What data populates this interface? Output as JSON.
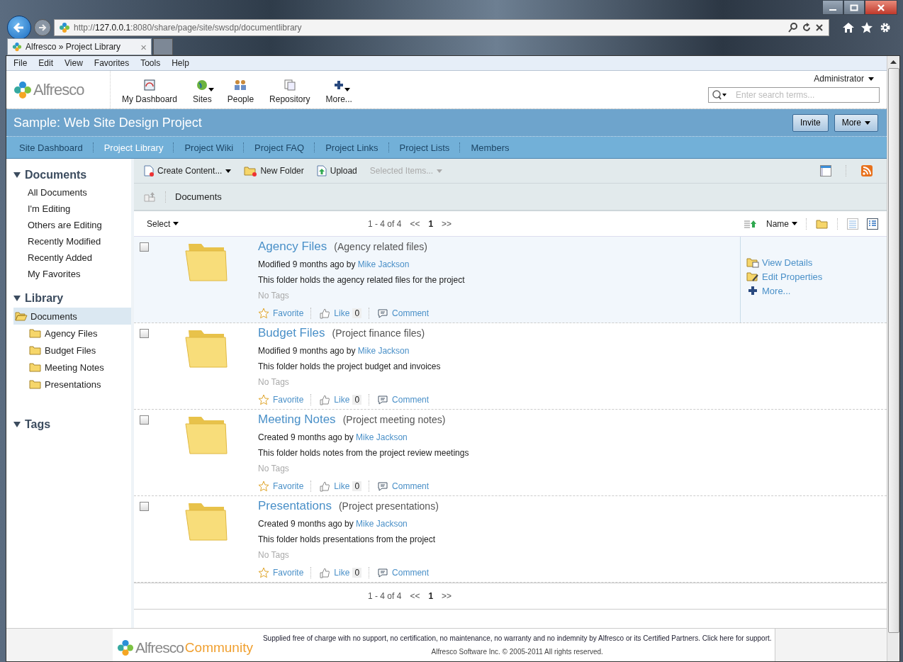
{
  "browser": {
    "url_host": "127.0.0.1",
    "url_prefix": "http://",
    "url_rest": ":8080/share/page/site/swsdp/documentlibrary",
    "tab_title": "Alfresco » Project Library",
    "tab_close": "×",
    "menu": [
      "File",
      "Edit",
      "View",
      "Favorites",
      "Tools",
      "Help"
    ]
  },
  "header": {
    "logo": "Alfresco",
    "nav": [
      {
        "label": "My Dashboard",
        "kind": "dashboard",
        "caret": false
      },
      {
        "label": "Sites",
        "kind": "sites",
        "caret": true
      },
      {
        "label": "People",
        "kind": "people",
        "caret": false
      },
      {
        "label": "Repository",
        "kind": "repository",
        "caret": false
      },
      {
        "label": "More...",
        "kind": "more",
        "caret": true
      }
    ],
    "user": "Administrator",
    "search_placeholder": "Enter search terms..."
  },
  "site": {
    "title": "Sample: Web Site Design Project",
    "buttons": [
      {
        "label": "Invite",
        "caret": false
      },
      {
        "label": "More",
        "caret": true
      }
    ],
    "nav": [
      {
        "label": "Site Dashboard",
        "selected": false
      },
      {
        "label": "Project Library",
        "selected": true
      },
      {
        "label": "Project Wiki",
        "selected": false
      },
      {
        "label": "Project FAQ",
        "selected": false
      },
      {
        "label": "Project Links",
        "selected": false
      },
      {
        "label": "Project Lists",
        "selected": false
      },
      {
        "label": "Members",
        "selected": false
      }
    ]
  },
  "sidebar": {
    "filters": {
      "title": "Documents",
      "expanded": true,
      "items": [
        "All Documents",
        "I'm Editing",
        "Others are Editing",
        "Recently Modified",
        "Recently Added",
        "My Favorites"
      ]
    },
    "library": {
      "title": "Library",
      "expanded": true,
      "tree": [
        {
          "label": "Documents",
          "selected": true,
          "expanded": true,
          "children": [
            {
              "label": "Agency Files",
              "selected": false
            },
            {
              "label": "Budget Files",
              "selected": false
            },
            {
              "label": "Meeting Notes",
              "selected": false
            },
            {
              "label": "Presentations",
              "selected": false
            }
          ]
        }
      ]
    },
    "tags": {
      "title": "Tags",
      "expanded": true
    }
  },
  "toolbar": {
    "actions": [
      {
        "label": "Create Content...",
        "kind": "create",
        "caret": true,
        "disabled": false
      },
      {
        "label": "New Folder",
        "kind": "folder",
        "caret": false,
        "disabled": false
      },
      {
        "label": "Upload",
        "kind": "upload",
        "caret": false,
        "disabled": false
      },
      {
        "label": "Selected Items...",
        "kind": "none",
        "caret": true,
        "disabled": true
      }
    ],
    "breadcrumb": "Documents"
  },
  "list": {
    "select": "Select",
    "sort": "Name",
    "pager": {
      "range": "1 - 4 of 4",
      "prev": "<<",
      "page": "1",
      "next": ">>"
    },
    "rows": [
      {
        "name": "Agency Files",
        "title": "(Agency related files)",
        "meta": "Modified 9 months ago by",
        "author": "Mike Jackson",
        "description": "This folder holds the agency related files for the project",
        "tags": "No Tags",
        "favorite": "Favorite",
        "like": "Like",
        "likes": "0",
        "comment": "Comment",
        "checked": false,
        "selected": true
      },
      {
        "name": "Budget Files",
        "title": "(Project finance files)",
        "meta": "Modified 9 months ago by",
        "author": "Mike Jackson",
        "description": "This folder holds the project budget and invoices",
        "tags": "No Tags",
        "favorite": "Favorite",
        "like": "Like",
        "likes": "0",
        "comment": "Comment",
        "checked": false,
        "selected": false
      },
      {
        "name": "Meeting Notes",
        "title": "(Project meeting notes)",
        "meta": "Created 9 months ago by",
        "author": "Mike Jackson",
        "description": "This folder holds notes from the project review meetings",
        "tags": "No Tags",
        "favorite": "Favorite",
        "like": "Like",
        "likes": "0",
        "comment": "Comment",
        "checked": false,
        "selected": false
      },
      {
        "name": "Presentations",
        "title": "(Project presentations)",
        "meta": "Created 9 months ago by",
        "author": "Mike Jackson",
        "description": "This folder holds presentations from the project",
        "tags": "No Tags",
        "favorite": "Favorite",
        "like": "Like",
        "likes": "0",
        "comment": "Comment",
        "checked": false,
        "selected": false
      }
    ],
    "bottom_pager": {
      "range": "1 - 4 of 4",
      "prev": "<<",
      "page": "1",
      "next": ">>"
    },
    "row_actions": [
      {
        "label": "View Details",
        "kind": "details"
      },
      {
        "label": "Edit Properties",
        "kind": "edit"
      },
      {
        "label": "More...",
        "kind": "more"
      }
    ]
  },
  "footer": {
    "logo": "Alfresco",
    "edition": "Community",
    "notice": "Supplied free of charge with no support, no certification, no maintenance, no warranty and no indemnity by Alfresco or its Certified Partners. Click here for support.",
    "copyright": "Alfresco Software Inc. © 2005-2011 All rights reserved."
  }
}
